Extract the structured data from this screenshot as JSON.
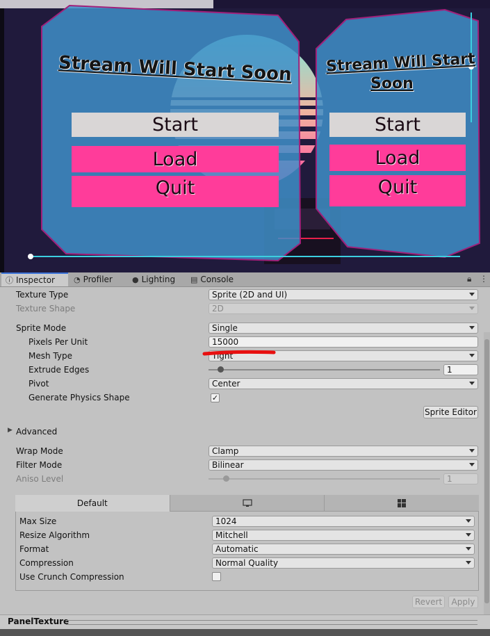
{
  "game_view": {
    "left_panel": {
      "title": "Stream Will Start Soon",
      "buttons": [
        "Start",
        "Load",
        "Quit"
      ]
    },
    "right_panel": {
      "title_line1": "Stream Will Start",
      "title_line2": "Soon",
      "buttons": [
        "Start",
        "Load",
        "Quit"
      ]
    },
    "colors": {
      "panel_fill": "#3f8fc8",
      "panel_border": "#a0207a",
      "button_start": "#d9d6d6",
      "button_pink": "#ff3c9a",
      "handle_line": "#3ccfe0"
    }
  },
  "tabs": [
    {
      "label": "Inspector",
      "icon": "info-icon",
      "active": true
    },
    {
      "label": "Profiler",
      "icon": "profiler-icon",
      "active": false
    },
    {
      "label": "Lighting",
      "icon": "lightbulb-icon",
      "active": false
    },
    {
      "label": "Console",
      "icon": "console-icon",
      "active": false
    }
  ],
  "inspector": {
    "texture_type": {
      "label": "Texture Type",
      "value": "Sprite (2D and UI)"
    },
    "texture_shape": {
      "label": "Texture Shape",
      "value": "2D"
    },
    "sprite_mode": {
      "label": "Sprite Mode",
      "value": "Single"
    },
    "pixels_per_unit": {
      "label": "Pixels Per Unit",
      "value": "15000"
    },
    "mesh_type": {
      "label": "Mesh Type",
      "value": "Tight"
    },
    "extrude_edges": {
      "label": "Extrude Edges",
      "value": "1"
    },
    "pivot": {
      "label": "Pivot",
      "value": "Center"
    },
    "generate_physics": {
      "label": "Generate Physics Shape",
      "checked": true
    },
    "sprite_editor_label": "Sprite Editor",
    "advanced_label": "Advanced",
    "wrap_mode": {
      "label": "Wrap Mode",
      "value": "Clamp"
    },
    "filter_mode": {
      "label": "Filter Mode",
      "value": "Bilinear"
    },
    "aniso_level": {
      "label": "Aniso Level",
      "value": "1"
    },
    "platform_tabs": {
      "default_label": "Default",
      "monitor_icon": "monitor-icon",
      "windows_icon": "windows-icon"
    },
    "max_size": {
      "label": "Max Size",
      "value": "1024"
    },
    "resize_algorithm": {
      "label": "Resize Algorithm",
      "value": "Mitchell"
    },
    "format": {
      "label": "Format",
      "value": "Automatic"
    },
    "compression": {
      "label": "Compression",
      "value": "Normal Quality"
    },
    "crunch": {
      "label": "Use Crunch Compression",
      "checked": false
    },
    "revert_label": "Revert",
    "apply_label": "Apply",
    "footer_name": "PanelTexture"
  },
  "annotation": {
    "color": "#e81010"
  }
}
